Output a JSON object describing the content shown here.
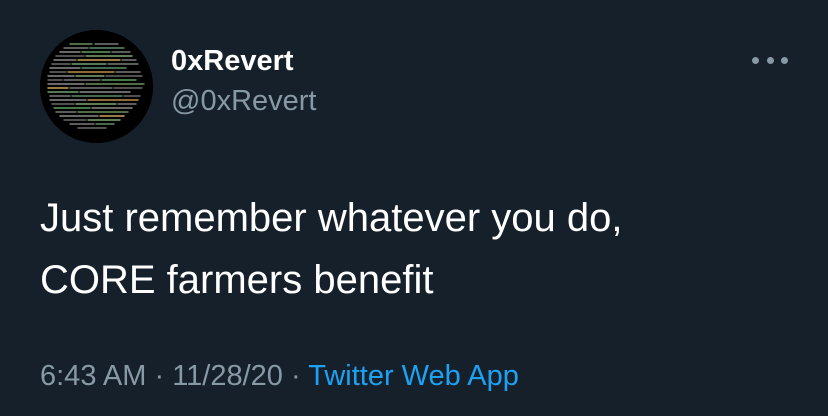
{
  "tweet": {
    "display_name": "0xRevert",
    "handle": "@0xRevert",
    "text_lines": [
      "Just remember whatever you do,",
      "CORE farmers benefit"
    ],
    "time": "6:43 AM",
    "separator": "·",
    "date": "11/28/20",
    "source": "Twitter Web App"
  },
  "icons": {
    "more": "more-options-icon",
    "avatar": "code-screenshot-avatar"
  },
  "colors": {
    "background": "#15202b",
    "text_primary": "#ffffff",
    "text_secondary": "#8899a6",
    "link": "#1da1f2"
  }
}
